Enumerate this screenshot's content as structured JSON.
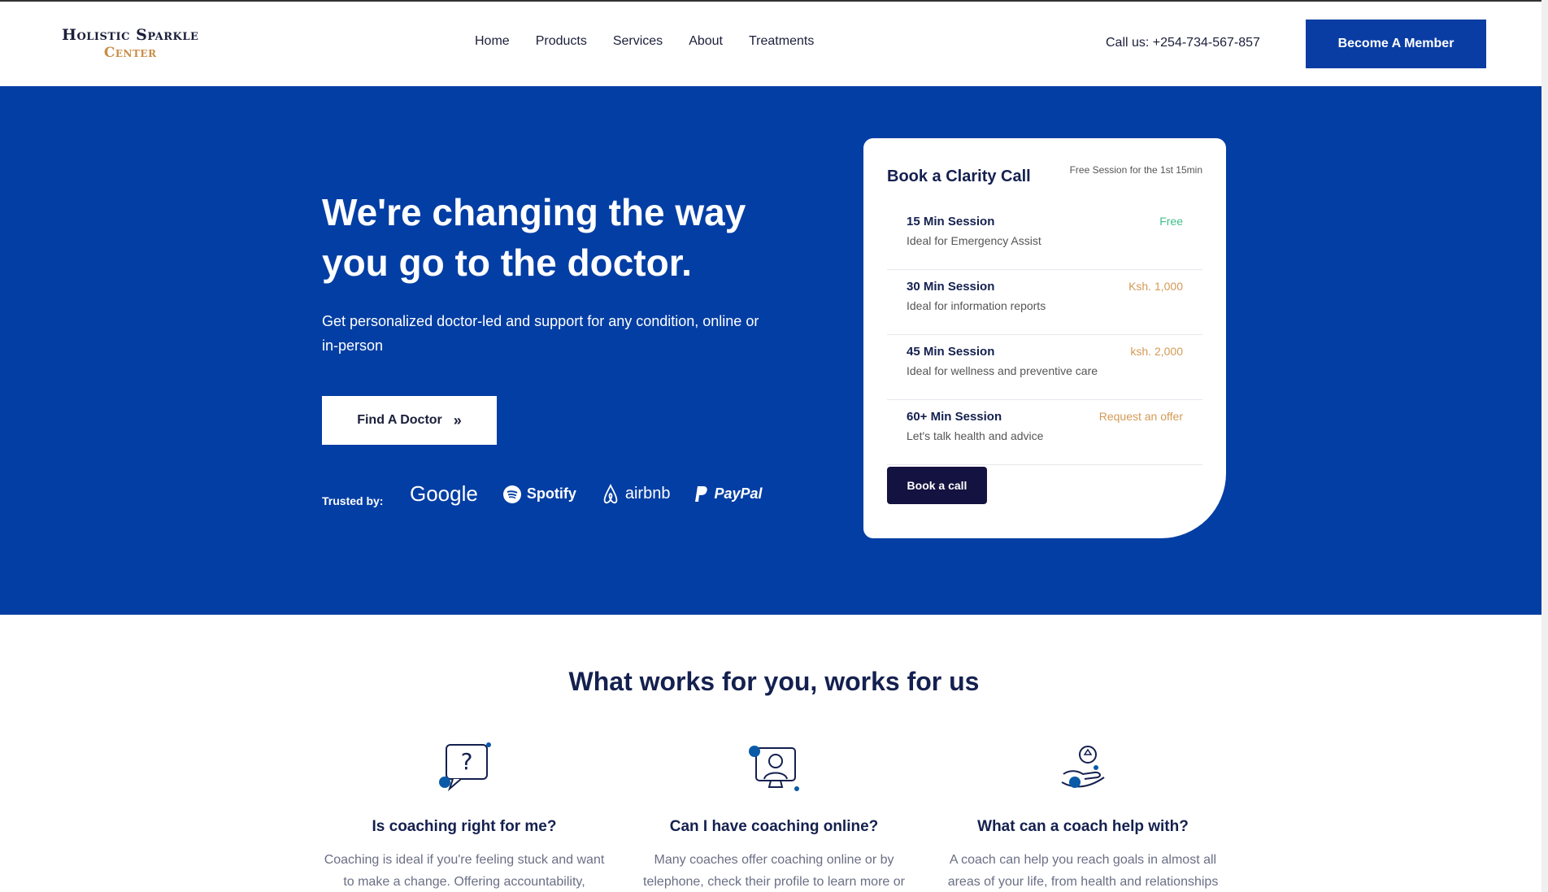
{
  "brand": {
    "line1": "Holistic Sparkle",
    "line2": "Center"
  },
  "nav": {
    "items": [
      "Home",
      "Products",
      "Services",
      "About",
      "Treatments"
    ]
  },
  "header": {
    "phone": "Call us: +254-734-567-857",
    "member_button": "Become A Member"
  },
  "hero": {
    "title": "We're changing the way you go to the doctor.",
    "subtitle": "Get personalized doctor-led and support for any condition, online or in-person",
    "cta": "Find A Doctor",
    "trusted_label": "Trusted by:",
    "trusted_brands": [
      "Google",
      "Spotify",
      "airbnb",
      "PayPal"
    ]
  },
  "booking": {
    "title": "Book a Clarity Call",
    "note": "Free Session for the 1st 15min",
    "sessions": [
      {
        "name": "15 Min Session",
        "desc": "Ideal for Emergency Assist",
        "price": "Free",
        "price_color": "#3fbf8a"
      },
      {
        "name": "30 Min Session",
        "desc": "Ideal for information reports",
        "price": "Ksh. 1,000",
        "price_color": "#d39a55"
      },
      {
        "name": "45 Min Session",
        "desc": "Ideal for wellness and preventive care",
        "price": "ksh. 2,000",
        "price_color": "#d39a55"
      },
      {
        "name": "60+ Min Session",
        "desc": "Let's talk health and advice",
        "price": "Request an offer",
        "price_color": "#d39a55"
      }
    ],
    "button": "Book a call"
  },
  "features": {
    "title": "What works for you, works for us",
    "items": [
      {
        "icon": "question-bubble-icon",
        "title": "Is coaching right for me?",
        "text": "Coaching is ideal if you're feeling stuck and want to make a change. Offering accountability,"
      },
      {
        "icon": "online-coach-icon",
        "title": "Can I have coaching online?",
        "text": "Many coaches offer coaching online or by telephone, check their profile to learn more or"
      },
      {
        "icon": "helping-hand-icon",
        "title": "What can a coach help with?",
        "text": "A coach can help you reach goals in almost all areas of your life, from health and relationships"
      }
    ]
  },
  "colors": {
    "primary": "#033ea4",
    "dark_navy": "#14204f",
    "accent_gold": "#c88d45"
  }
}
